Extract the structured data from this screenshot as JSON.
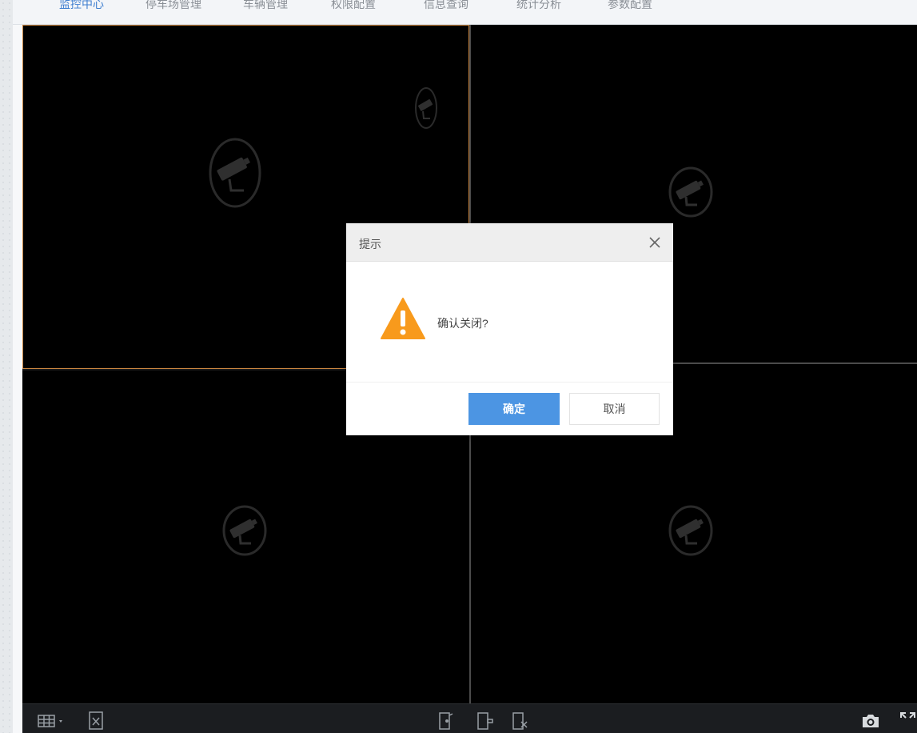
{
  "nav": {
    "items": [
      {
        "label": "监控中心",
        "active": true
      },
      {
        "label": "停车场管理",
        "active": false
      },
      {
        "label": "车辆管理",
        "active": false
      },
      {
        "label": "权限配置",
        "active": false
      },
      {
        "label": "信息查询",
        "active": false
      },
      {
        "label": "统计分析",
        "active": false
      },
      {
        "label": "参数配置",
        "active": false
      }
    ]
  },
  "video": {
    "layout": "2x2",
    "cells": [
      {
        "state": "no-signal",
        "selected": true
      },
      {
        "state": "no-signal",
        "selected": false
      },
      {
        "state": "no-signal",
        "selected": false
      },
      {
        "state": "no-signal",
        "selected": false
      }
    ]
  },
  "toolbar": {
    "left": [
      "grid-layout-icon",
      "close-all-icon"
    ],
    "center": [
      "door-open-icon",
      "door-lock-icon",
      "door-clear-icon"
    ],
    "right": [
      "capture-icon",
      "fullscreen-icon"
    ]
  },
  "dialog": {
    "title": "提示",
    "message": "确认关闭?",
    "ok_label": "确定",
    "cancel_label": "取消",
    "icon": "warning-icon"
  },
  "colors": {
    "ok_button": "#4c95e3",
    "warning": "#f89a1c",
    "selected_border": "#c8843f",
    "nav_active": "#3f7fd0"
  }
}
